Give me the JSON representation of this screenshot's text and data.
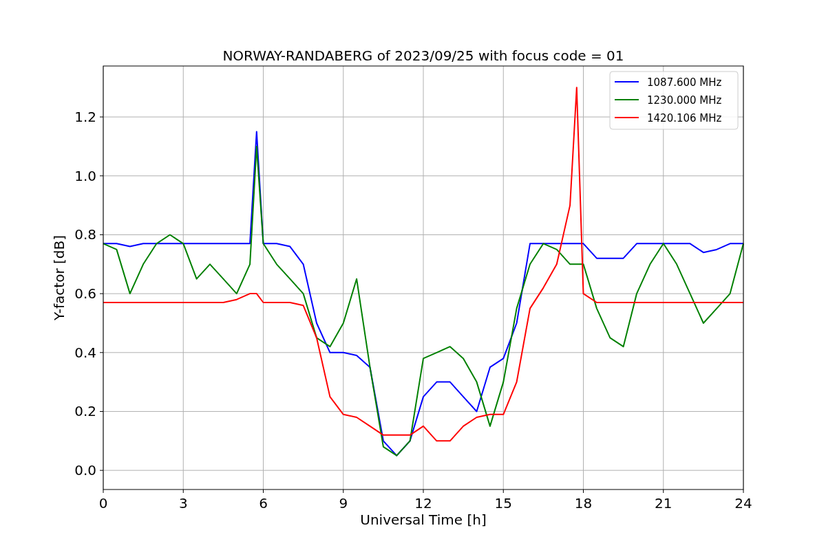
{
  "figure": {
    "chart_data": {
      "type": "line",
      "title": "NORWAY-RANDABERG of 2023/09/25 with focus code = 01",
      "xlabel": "Universal Time [h]",
      "ylabel": "Y-factor [dB]",
      "x": [
        0,
        0.5,
        1,
        1.5,
        2,
        2.5,
        3,
        3.5,
        4,
        4.5,
        5,
        5.5,
        5.75,
        6,
        6.5,
        7,
        7.5,
        8,
        8.5,
        9,
        9.5,
        10,
        10.5,
        11,
        11.5,
        12,
        12.5,
        13,
        13.5,
        14,
        14.5,
        15,
        15.5,
        16,
        16.5,
        17,
        17.5,
        17.75,
        18,
        18.5,
        19,
        19.5,
        20,
        20.5,
        21,
        21.5,
        22,
        22.5,
        23,
        23.5,
        24
      ],
      "series": [
        {
          "name": "1087.600 MHz",
          "color": "#0000ff",
          "values": [
            0.77,
            0.77,
            0.76,
            0.77,
            0.77,
            0.77,
            0.77,
            0.77,
            0.77,
            0.77,
            0.77,
            0.77,
            1.15,
            0.77,
            0.77,
            0.76,
            0.7,
            0.5,
            0.4,
            0.4,
            0.39,
            0.35,
            0.1,
            0.05,
            0.1,
            0.25,
            0.3,
            0.3,
            0.25,
            0.2,
            0.35,
            0.38,
            0.5,
            0.77,
            0.77,
            0.77,
            0.77,
            0.77,
            0.77,
            0.72,
            0.72,
            0.72,
            0.77,
            0.77,
            0.77,
            0.77,
            0.77,
            0.74,
            0.75,
            0.77,
            0.77
          ]
        },
        {
          "name": "1230.000 MHz",
          "color": "#008000",
          "values": [
            0.77,
            0.75,
            0.6,
            0.7,
            0.77,
            0.8,
            0.77,
            0.65,
            0.7,
            0.65,
            0.6,
            0.7,
            1.1,
            0.77,
            0.7,
            0.65,
            0.6,
            0.45,
            0.42,
            0.5,
            0.65,
            0.35,
            0.08,
            0.05,
            0.1,
            0.38,
            0.4,
            0.42,
            0.38,
            0.3,
            0.15,
            0.3,
            0.55,
            0.7,
            0.77,
            0.75,
            0.7,
            0.7,
            0.7,
            0.55,
            0.45,
            0.42,
            0.6,
            0.7,
            0.77,
            0.7,
            0.6,
            0.5,
            0.55,
            0.6,
            0.77
          ]
        },
        {
          "name": "1420.106 MHz",
          "color": "#ff0000",
          "values": [
            0.57,
            0.57,
            0.57,
            0.57,
            0.57,
            0.57,
            0.57,
            0.57,
            0.57,
            0.57,
            0.58,
            0.6,
            0.6,
            0.57,
            0.57,
            0.57,
            0.56,
            0.45,
            0.25,
            0.19,
            0.18,
            0.15,
            0.12,
            0.12,
            0.12,
            0.15,
            0.1,
            0.1,
            0.15,
            0.18,
            0.19,
            0.19,
            0.3,
            0.55,
            0.62,
            0.7,
            0.9,
            1.3,
            0.6,
            0.57,
            0.57,
            0.57,
            0.57,
            0.57,
            0.57,
            0.57,
            0.57,
            0.57,
            0.57,
            0.57,
            0.57
          ]
        }
      ],
      "grid": true,
      "legend": true,
      "xlim": [
        0,
        24
      ],
      "ylim": [
        -0.065,
        1.373
      ],
      "xticks": [
        0,
        3,
        6,
        9,
        12,
        15,
        18,
        21,
        24
      ],
      "yticks": [
        {
          "value": 0,
          "label": "0.0"
        },
        {
          "value": 0.2,
          "label": "0.2"
        },
        {
          "value": 0.4,
          "label": "0.4"
        },
        {
          "value": 0.6,
          "label": "0.6"
        },
        {
          "value": 0.8,
          "label": "0.8"
        },
        {
          "value": 1.0,
          "label": "1.0"
        },
        {
          "value": 1.2,
          "label": "1.2"
        }
      ]
    }
  }
}
